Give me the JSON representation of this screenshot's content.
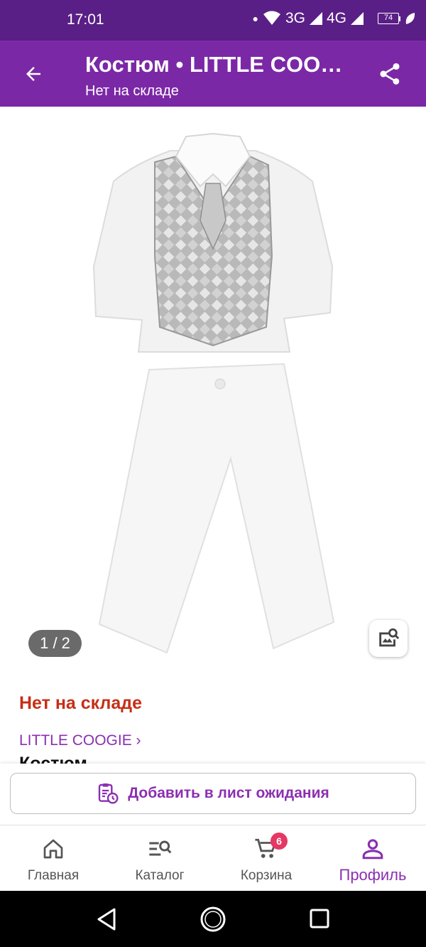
{
  "status_bar": {
    "time": "17:01",
    "network_3g": "3G",
    "network_4g": "4G",
    "battery": "74"
  },
  "app_bar": {
    "title": "Костюм • LITTLE COO…",
    "subtitle": "Нет на складе",
    "back_icon": "arrow-left-icon",
    "share_icon": "share-icon"
  },
  "gallery": {
    "counter": "1 / 2",
    "search_icon": "image-search-icon"
  },
  "product": {
    "stock_status": "Нет на складе",
    "brand_link": "LITTLE COOGIE ›",
    "name": "Костюм"
  },
  "waitlist": {
    "label": "Добавить в лист ожидания",
    "icon": "clipboard-clock-icon"
  },
  "bottom_nav": {
    "items": [
      {
        "label": "Главная",
        "icon": "home-icon"
      },
      {
        "label": "Каталог",
        "icon": "catalog-search-icon"
      },
      {
        "label": "Корзина",
        "icon": "cart-icon",
        "badge": "6"
      },
      {
        "label": "Профиль",
        "icon": "profile-icon"
      }
    ]
  },
  "colors": {
    "brand_purple": "#7b28a6",
    "status_purple": "#5a1f86",
    "accent_purple": "#8b2fb1",
    "stock_red": "#c62f16",
    "badge_pink": "#e53863"
  }
}
